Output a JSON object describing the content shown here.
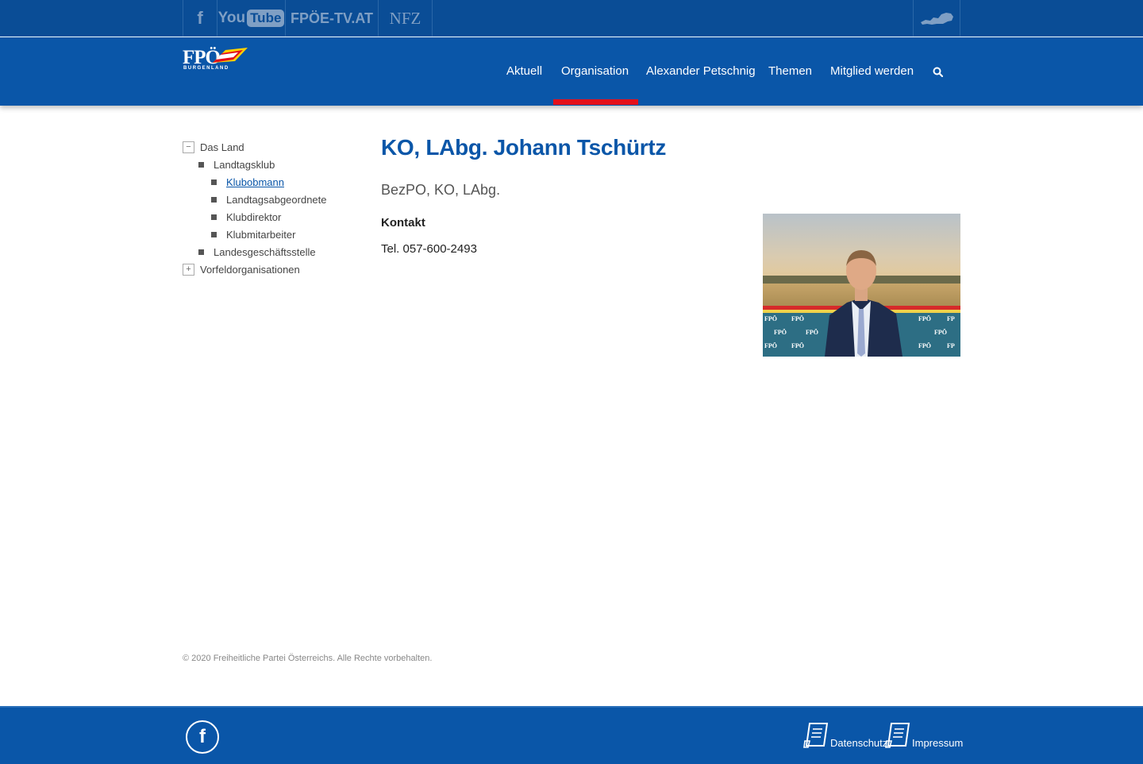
{
  "topbar": {
    "facebook_icon": "facebook-icon",
    "youtube": {
      "you": "You",
      "tube": "Tube"
    },
    "fpoe_tv": "FPÖE-TV.AT",
    "nfz": "NFZ",
    "map_icon": "austria-map-icon"
  },
  "header": {
    "logo": {
      "main": "FPÖ",
      "sub": "BURGENLAND"
    },
    "nav": [
      {
        "label": "Aktuell"
      },
      {
        "label": "Organisation",
        "active": true
      },
      {
        "label": "Alexander Petschnig"
      },
      {
        "label": "Themen"
      },
      {
        "label": "Mitglied werden"
      }
    ],
    "search_icon": "search-icon",
    "active_color": "#e3101a"
  },
  "sidebar": {
    "items": [
      {
        "label": "Das Land",
        "toggle": "−"
      },
      {
        "label": "Landtagsklub"
      },
      {
        "label": "Klubobmann",
        "active": true
      },
      {
        "label": "Landtagsabgeordnete"
      },
      {
        "label": "Klubdirektor"
      },
      {
        "label": "Klubmitarbeiter"
      },
      {
        "label": "Landesgeschäftsstelle"
      },
      {
        "label": "Vorfeldorganisationen",
        "toggle": "+"
      }
    ]
  },
  "main": {
    "title": "KO, LAbg. Johann Tschürtz",
    "subtitle": "BezPO, KO, LAbg.",
    "contact_heading": "Kontakt",
    "contact_tel": "Tel. 057-600-2493"
  },
  "copyright": "© 2020 Freiheitliche Partei Österreichs. Alle Rechte vorbehalten.",
  "footer": {
    "facebook_icon": "facebook-icon",
    "facebook_glyph": "f",
    "links": [
      {
        "label": "Datenschutz",
        "icon": "document-icon"
      },
      {
        "label": "Impressum",
        "icon": "document-icon"
      }
    ]
  },
  "colors": {
    "brand_blue": "#0a56a8",
    "topbar_blue": "#0a4d96",
    "accent_red": "#e3101a"
  }
}
